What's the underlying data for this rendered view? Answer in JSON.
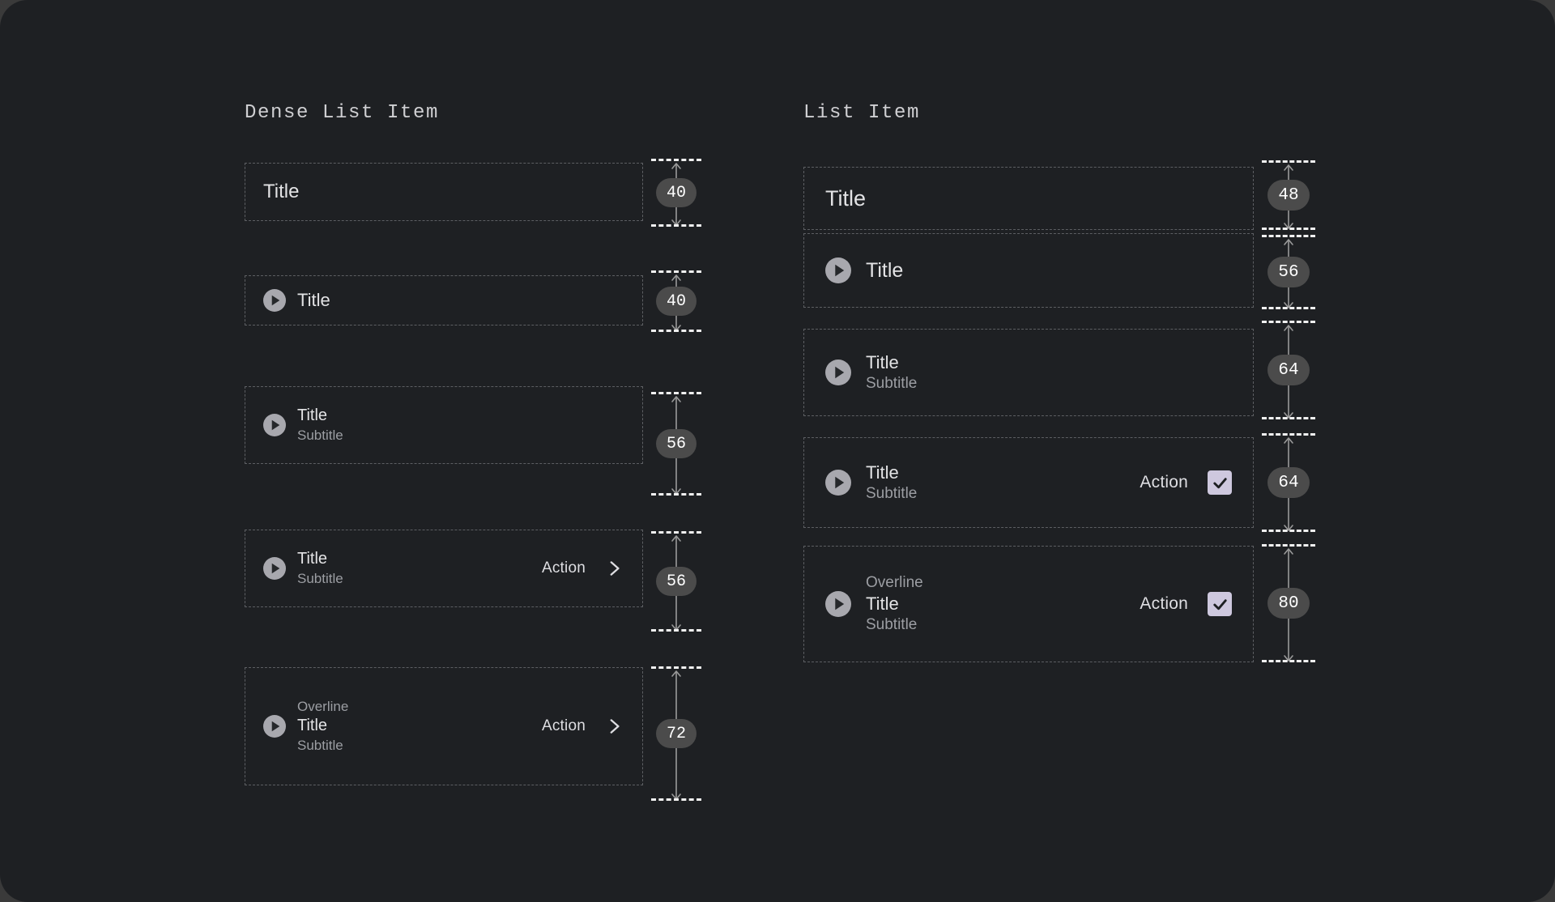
{
  "page": {
    "background": "#1e2023",
    "surround": "#3a3a3a"
  },
  "colors": {
    "dashed_border": "#5d5f63",
    "measure_dash": "#f0f0f0",
    "badge_bg": "#4b4b4b",
    "badge_text": "#ffffff",
    "title_text": "#e3e3e5",
    "muted_text": "#9c9ea3",
    "action_text": "#dedee2",
    "play_icon_circle": "#a8a8ae",
    "play_icon_glyph": "#26282b",
    "checkbox_fill": "#cec8de",
    "checkbox_check": "#1d1f22"
  },
  "columns": [
    {
      "id": "dense",
      "heading": "Dense List Item",
      "rows": [
        {
          "height_label": "40",
          "icon": null,
          "overline": null,
          "title": "Title",
          "subtitle": null,
          "action_label": null,
          "action_icon": null
        },
        {
          "height_label": "40",
          "icon": "play-circle-icon",
          "overline": null,
          "title": "Title",
          "subtitle": null,
          "action_label": null,
          "action_icon": null
        },
        {
          "height_label": "56",
          "icon": "play-circle-icon",
          "overline": null,
          "title": "Title",
          "subtitle": "Subtitle",
          "action_label": null,
          "action_icon": null
        },
        {
          "height_label": "56",
          "icon": "play-circle-icon",
          "overline": null,
          "title": "Title",
          "subtitle": "Subtitle",
          "action_label": "Action",
          "action_icon": "chevron-right-icon"
        },
        {
          "height_label": "72",
          "icon": "play-circle-icon",
          "overline": "Overline",
          "title": "Title",
          "subtitle": "Subtitle",
          "action_label": "Action",
          "action_icon": "chevron-right-icon"
        }
      ]
    },
    {
      "id": "standard",
      "heading": "List Item",
      "rows": [
        {
          "height_label": "48",
          "icon": null,
          "overline": null,
          "title": "Title",
          "subtitle": null,
          "action_label": null,
          "action_icon": null
        },
        {
          "height_label": "56",
          "icon": "play-circle-icon",
          "overline": null,
          "title": "Title",
          "subtitle": null,
          "action_label": null,
          "action_icon": null
        },
        {
          "height_label": "64",
          "icon": "play-circle-icon",
          "overline": null,
          "title": "Title",
          "subtitle": "Subtitle",
          "action_label": null,
          "action_icon": null
        },
        {
          "height_label": "64",
          "icon": "play-circle-icon",
          "overline": null,
          "title": "Title",
          "subtitle": "Subtitle",
          "action_label": "Action",
          "action_icon": "checkbox-checked-icon"
        },
        {
          "height_label": "80",
          "icon": "play-circle-icon",
          "overline": "Overline",
          "title": "Title",
          "subtitle": "Subtitle",
          "action_label": "Action",
          "action_icon": "checkbox-checked-icon"
        }
      ]
    }
  ]
}
